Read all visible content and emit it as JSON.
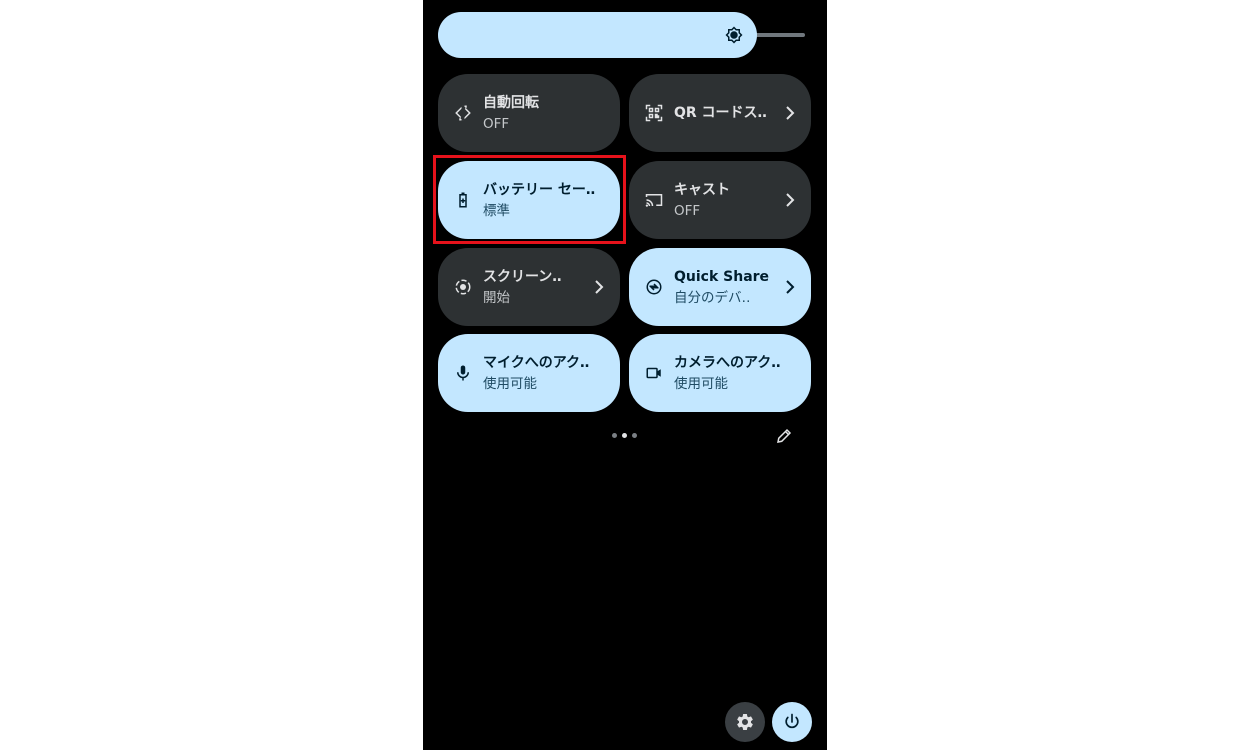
{
  "quick_settings": {
    "brightness": {
      "icon": "brightness-icon",
      "level": 0.88
    },
    "tiles": [
      {
        "label": "自動回転",
        "sub": "OFF",
        "state": "off",
        "icon": "rotate-icon",
        "chevron": false
      },
      {
        "label": "QR コードス‥",
        "sub": "",
        "state": "off",
        "icon": "qr-scan-icon",
        "chevron": true
      },
      {
        "label": "バッテリー セー‥",
        "sub": "標準",
        "state": "on",
        "icon": "battery-saver-icon",
        "chevron": false
      },
      {
        "label": "キャスト",
        "sub": "OFF",
        "state": "off",
        "icon": "cast-icon",
        "chevron": true
      },
      {
        "label": "スクリーン‥",
        "sub": "開始",
        "state": "off",
        "icon": "screen-record-icon",
        "chevron": true
      },
      {
        "label": "Quick Share",
        "sub": "自分のデバ‥",
        "state": "on",
        "icon": "quick-share-icon",
        "chevron": true
      },
      {
        "label": "マイクへのアク‥",
        "sub": "使用可能",
        "state": "on",
        "icon": "microphone-icon",
        "chevron": false
      },
      {
        "label": "カメラへのアク‥",
        "sub": "使用可能",
        "state": "on",
        "icon": "camera-icon",
        "chevron": false
      }
    ],
    "pager": {
      "pages": 3,
      "current": 2
    },
    "colors": {
      "tile_on": "#c3e7ff",
      "tile_off": "#2d3133",
      "highlight": "#e6121b",
      "background": "#000000"
    }
  }
}
